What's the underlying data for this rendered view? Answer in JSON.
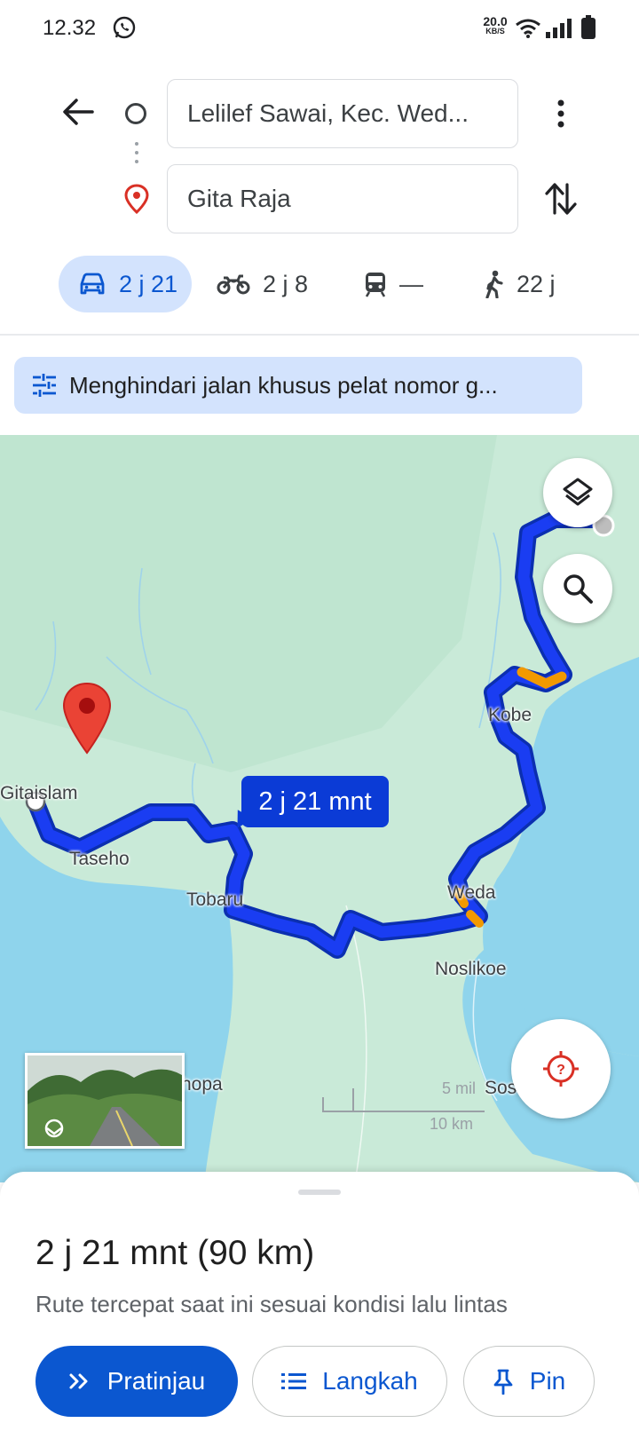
{
  "status_bar": {
    "time": "12.32",
    "net_speed_value": "20.0",
    "net_speed_unit": "KB/S",
    "icons": [
      "whatsapp-icon",
      "wifi-icon",
      "signal-icon",
      "battery-icon"
    ]
  },
  "directions": {
    "origin": "Lelilef Sawai, Kec. Wed...",
    "destination": "Gita Raja",
    "icons": [
      "back-arrow-icon",
      "origin-circle-icon",
      "destination-pin-icon",
      "more-vert-icon",
      "swap-icon"
    ]
  },
  "travel_modes": [
    {
      "name": "car",
      "icon": "car-icon",
      "label": "2 j 21",
      "active": true
    },
    {
      "name": "motorcycle",
      "icon": "motorcycle-icon",
      "label": "2 j 8",
      "active": false
    },
    {
      "name": "transit",
      "icon": "train-icon",
      "label": "—",
      "active": false
    },
    {
      "name": "walk",
      "icon": "walk-icon",
      "label": "22 j",
      "active": false
    }
  ],
  "filter_chip": {
    "icon": "tune-icon",
    "label": "Menghindari jalan khusus pelat nomor g..."
  },
  "map": {
    "eta_bubble": "2 j 21 mnt",
    "places": [
      "Gitaislam",
      "Taseho",
      "Tobaru",
      "Kobe",
      "Weda",
      "Noslikoe",
      "Sos",
      "hopa"
    ],
    "scale": {
      "miles": "5 mil",
      "km": "10 km"
    },
    "colors": {
      "route": "#1a3df2",
      "traffic": "#f29900",
      "water": "#8fd4ec",
      "land": "#c9ead8",
      "pin": "#ea4335"
    }
  },
  "sheet": {
    "title": "2 j 21 mnt (90 km)",
    "subtitle": "Rute tercepat saat ini sesuai kondisi lalu lintas",
    "buttons": {
      "preview": "Pratinjau",
      "steps": "Langkah",
      "pin": "Pin"
    }
  }
}
